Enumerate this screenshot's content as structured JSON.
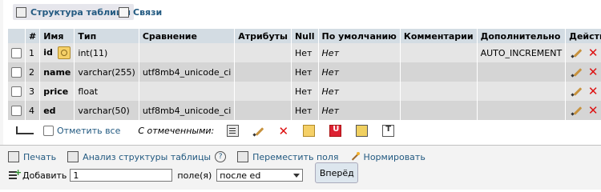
{
  "tabs": [
    {
      "label": "Структура таблицы",
      "icon": "structure-icon",
      "active": true
    },
    {
      "label": "Связи",
      "icon": "relations-icon",
      "active": false
    }
  ],
  "table": {
    "headers": [
      "",
      "#",
      "Имя",
      "Тип",
      "Сравнение",
      "Атрибуты",
      "Null",
      "По умолчанию",
      "Комментарии",
      "Дополнительно",
      "Действие"
    ],
    "rows": [
      {
        "num": "1",
        "name": "id",
        "type": "int(11)",
        "collation": "",
        "attributes": "",
        "null": "Нет",
        "default": "Нет",
        "comment": "",
        "extra": "AUTO_INCREMENT"
      },
      {
        "num": "2",
        "name": "name",
        "type": "varchar(255)",
        "collation": "utf8mb4_unicode_ci",
        "attributes": "",
        "null": "Нет",
        "default": "Нет",
        "comment": "",
        "extra": ""
      },
      {
        "num": "3",
        "name": "price",
        "type": "float",
        "collation": "",
        "attributes": "",
        "null": "Нет",
        "default": "Нет",
        "comment": "",
        "extra": ""
      },
      {
        "num": "4",
        "name": "ed",
        "type": "varchar(50)",
        "collation": "utf8mb4_unicode_ci",
        "attributes": "",
        "null": "Нет",
        "default": "Нет",
        "comment": "",
        "extra": ""
      }
    ]
  },
  "selection": {
    "select_all_label": "Отметить все",
    "with_selected_label": "С отмеченными:"
  },
  "footer": {
    "print_label": "Печать",
    "analyze_label": "Анализ структуры таблицы",
    "move_label": "Переместить поля",
    "normalize_label": "Нормировать",
    "add_label": "Добавить",
    "add_value": "1",
    "fields_label": "поле(я)",
    "position_value": "после ed",
    "go_label": "Вперёд"
  }
}
